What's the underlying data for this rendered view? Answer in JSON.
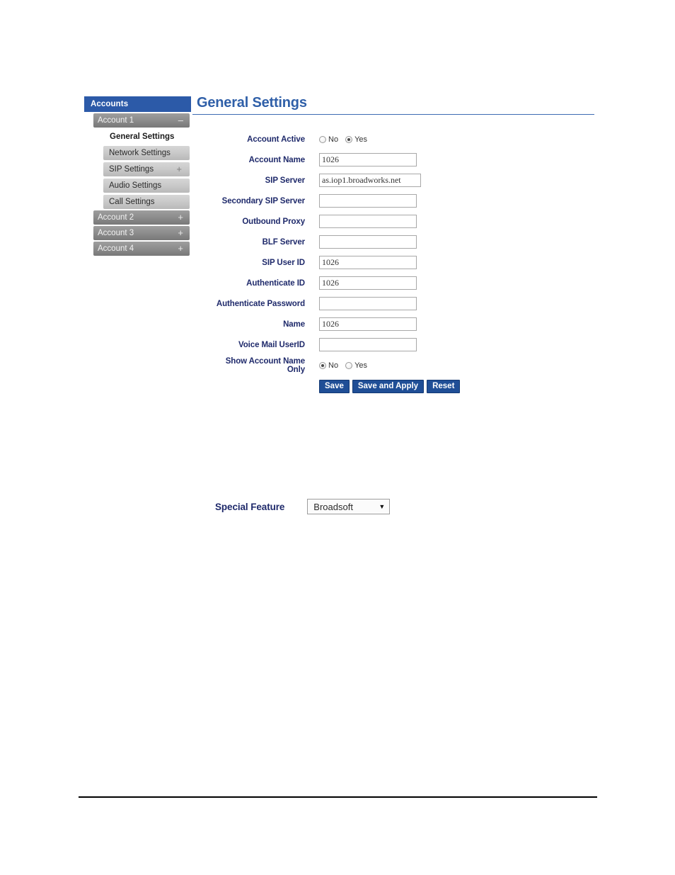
{
  "sidebar": {
    "header": "Accounts",
    "groups": [
      {
        "label": "Account 1",
        "sign": "–",
        "items": [
          {
            "label": "General Settings",
            "sign": "",
            "active": true
          },
          {
            "label": "Network Settings",
            "sign": "",
            "active": false
          },
          {
            "label": "SIP Settings",
            "sign": "+",
            "active": false
          },
          {
            "label": "Audio Settings",
            "sign": "",
            "active": false
          },
          {
            "label": "Call Settings",
            "sign": "",
            "active": false
          }
        ]
      },
      {
        "label": "Account 2",
        "sign": "+",
        "items": []
      },
      {
        "label": "Account 3",
        "sign": "+",
        "items": []
      },
      {
        "label": "Account 4",
        "sign": "+",
        "items": []
      }
    ]
  },
  "page": {
    "title": "General Settings"
  },
  "form": {
    "rows": [
      {
        "label": "Account Active",
        "type": "radio",
        "options": [
          "No",
          "Yes"
        ],
        "selected": "Yes"
      },
      {
        "label": "Account Name",
        "type": "text",
        "value": "1026"
      },
      {
        "label": "SIP Server",
        "type": "text",
        "value": "as.iop1.broadworks.net",
        "wide": true
      },
      {
        "label": "Secondary SIP Server",
        "type": "text",
        "value": ""
      },
      {
        "label": "Outbound Proxy",
        "type": "text",
        "value": ""
      },
      {
        "label": "BLF Server",
        "type": "text",
        "value": ""
      },
      {
        "label": "SIP User ID",
        "type": "text",
        "value": "1026"
      },
      {
        "label": "Authenticate ID",
        "type": "text",
        "value": "1026"
      },
      {
        "label": "Authenticate Password",
        "type": "text",
        "value": ""
      },
      {
        "label": "Name",
        "type": "text",
        "value": "1026"
      },
      {
        "label": "Voice Mail UserID",
        "type": "text",
        "value": ""
      },
      {
        "label": "Show Account Name Only",
        "type": "radio",
        "options": [
          "No",
          "Yes"
        ],
        "selected": "No"
      }
    ],
    "buttons": [
      {
        "label": "Save"
      },
      {
        "label": "Save and Apply"
      },
      {
        "label": "Reset"
      }
    ]
  },
  "special_feature": {
    "label": "Special Feature",
    "value": "Broadsoft",
    "arrow": "▼"
  },
  "colors": {
    "header_blue": "#2c5aa8",
    "title_blue": "#2f5fa8",
    "label_navy": "#1f2a6b",
    "button_blue": "#1f4e96"
  }
}
